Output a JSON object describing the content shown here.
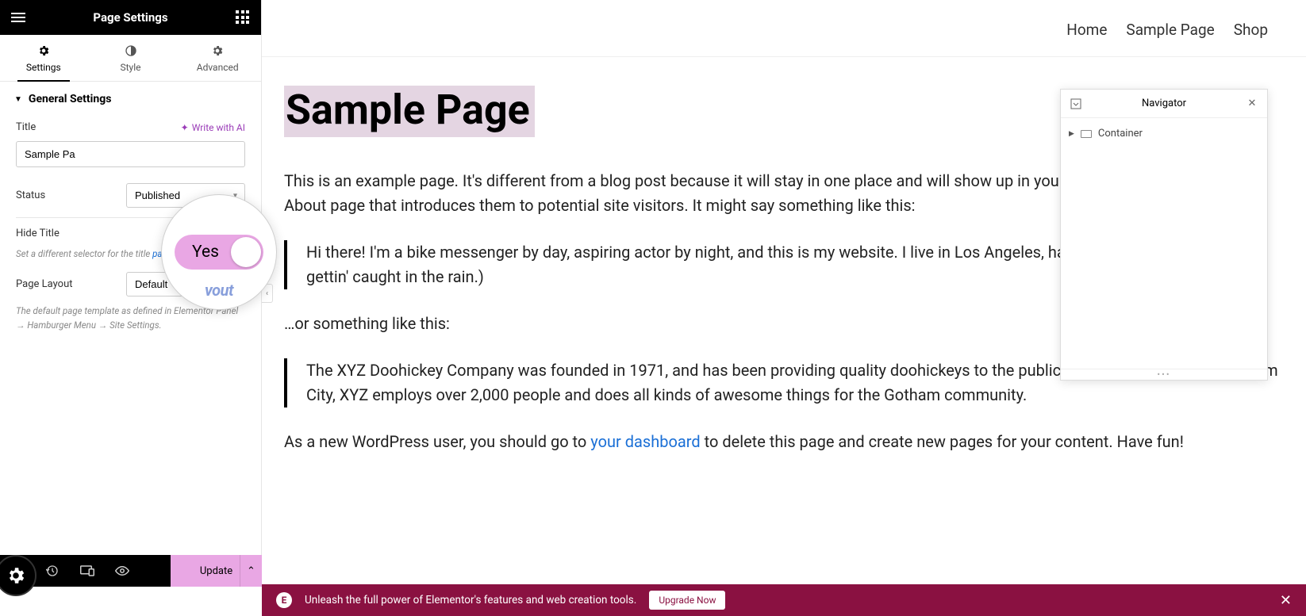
{
  "panel": {
    "title": "Page Settings",
    "tabs": {
      "settings": "Settings",
      "style": "Style",
      "advanced": "Advanced"
    },
    "section_general": "General Settings",
    "title_label": "Title",
    "write_ai": "Write with AI",
    "title_value": "Sample Pa",
    "status_label": "Status",
    "status_value": "Published",
    "hide_title_label": "Hide Title",
    "hide_title_hint_pre": "Set a different selector for the title ",
    "hide_title_hint_link": "panel",
    "page_layout_label": "Page Layout",
    "page_layout_value": "Default",
    "page_layout_hint": "The default page template as defined in Elementor Panel → Hamburger Menu → Site Settings.",
    "toggle_yes": "Yes",
    "ghost_text": "vout"
  },
  "bottom": {
    "update": "Update"
  },
  "nav": {
    "items": [
      "Home",
      "Sample Page",
      "Shop"
    ]
  },
  "content": {
    "title": "Sample Page",
    "p1": "This is an example page. It's different from a blog post because it will stay in one place and will show up in your site nav people start with an About page that introduces them to potential site visitors. It might say something like this:",
    "q1": "Hi there! I'm a bike messenger by day, aspiring actor by night, and this is my website. I live in Los Angeles, have a g piña coladas. (And gettin' caught in the rain.)",
    "p2": "…or something like this:",
    "q2": "The XYZ Doohickey Company was founded in 1971, and has been providing quality doohickeys to the public ever since. Located in Gotham City, XYZ employs over 2,000 people and does all kinds of awesome things for the Gotham community.",
    "p3_pre": "As a new WordPress user, you should go to ",
    "p3_link": "your dashboard",
    "p3_post": " to delete this page and create new pages for your content. Have fun!"
  },
  "navigator": {
    "title": "Navigator",
    "item": "Container"
  },
  "promo": {
    "text": "Unleash the full power of Elementor's features and web creation tools.",
    "cta": "Upgrade Now"
  }
}
